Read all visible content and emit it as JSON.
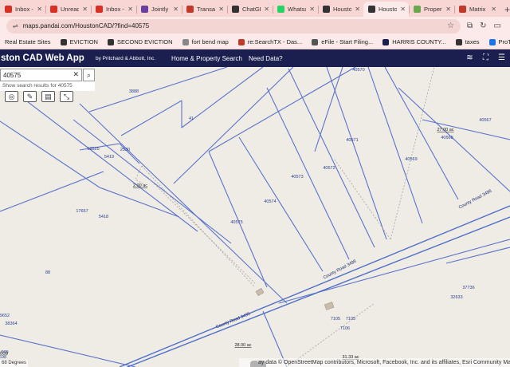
{
  "tabs": [
    {
      "label": "Inbox -",
      "color": "#d93025"
    },
    {
      "label": "Unread",
      "color": "#d93025"
    },
    {
      "label": "Inbox -",
      "color": "#d93025"
    },
    {
      "label": "Jointly",
      "color": "#6b3fa0"
    },
    {
      "label": "Transac",
      "color": "#c0392b"
    },
    {
      "label": "ChatGP",
      "color": "#333333"
    },
    {
      "label": "Whatsa",
      "color": "#25d366"
    },
    {
      "label": "Housto",
      "color": "#333333"
    },
    {
      "label": "Housto",
      "color": "#333333",
      "active": true
    },
    {
      "label": "Proper",
      "color": "#6aa84f"
    },
    {
      "label": "Matrix",
      "color": "#c0392b"
    }
  ],
  "address": {
    "url": "maps.pandai.com/HoustonCAD/?find=40575"
  },
  "bookmarks": [
    {
      "label": "Real Estate Sites",
      "color": ""
    },
    {
      "label": "EVICTION",
      "color": "#333333"
    },
    {
      "label": "SECOND EVICTION",
      "color": "#333333"
    },
    {
      "label": "fort bend map",
      "color": "#888888"
    },
    {
      "label": "re:SearchTX - Das...",
      "color": "#c0392b"
    },
    {
      "label": "eFile - Start Filing...",
      "color": "#555555"
    },
    {
      "label": "HARRIS COUNTY...",
      "color": "#1b1f4f"
    },
    {
      "label": "taxes",
      "color": "#333333"
    },
    {
      "label": "ProTeck Partner Po...",
      "color": "#1a73e8"
    }
  ],
  "header": {
    "title": "ston CAD Web App",
    "byline": "by Pritchard & Abbott, Inc.",
    "nav": [
      "Home & Property Search",
      "Need Data?"
    ]
  },
  "search": {
    "value": "40575",
    "suggestion": "Show search results for 40575"
  },
  "map": {
    "labels": [
      {
        "text": "3888"
      },
      {
        "text": "41"
      },
      {
        "text": "40570"
      },
      {
        "text": "40567"
      },
      {
        "text": "18525"
      },
      {
        "text": "2530"
      },
      {
        "text": "5419"
      },
      {
        "text": "40571"
      },
      {
        "text": "27.00 ac"
      },
      {
        "text": "40568"
      },
      {
        "text": "40569"
      },
      {
        "text": "40572"
      },
      {
        "text": "40573"
      },
      {
        "text": "2.00 ac"
      },
      {
        "text": "17657"
      },
      {
        "text": "5418"
      },
      {
        "text": "40574"
      },
      {
        "text": "40575"
      },
      {
        "text": "County Road 3496"
      },
      {
        "text": "County Road 3496"
      },
      {
        "text": "County Road 3495"
      },
      {
        "text": "88"
      },
      {
        "text": "37736"
      },
      {
        "text": "32633"
      },
      {
        "text": "7105"
      },
      {
        "text": "7105"
      },
      {
        "text": "7106"
      },
      {
        "text": "9652"
      },
      {
        "text": "38364"
      },
      {
        "text": "28.00 ac"
      },
      {
        "text": "31.33 ac"
      },
      {
        "text": "009"
      },
      {
        "text": "5698"
      }
    ]
  },
  "attribution": "ay data © OpenStreetMap contributors, Microsoft, Facebook, Inc. and its affiliates, Esri Community Maps",
  "scale": "68 Degrees",
  "colors": {
    "parcel": "#5b73c9",
    "road": "#4f6fc8",
    "header": "#1b1f4f"
  }
}
